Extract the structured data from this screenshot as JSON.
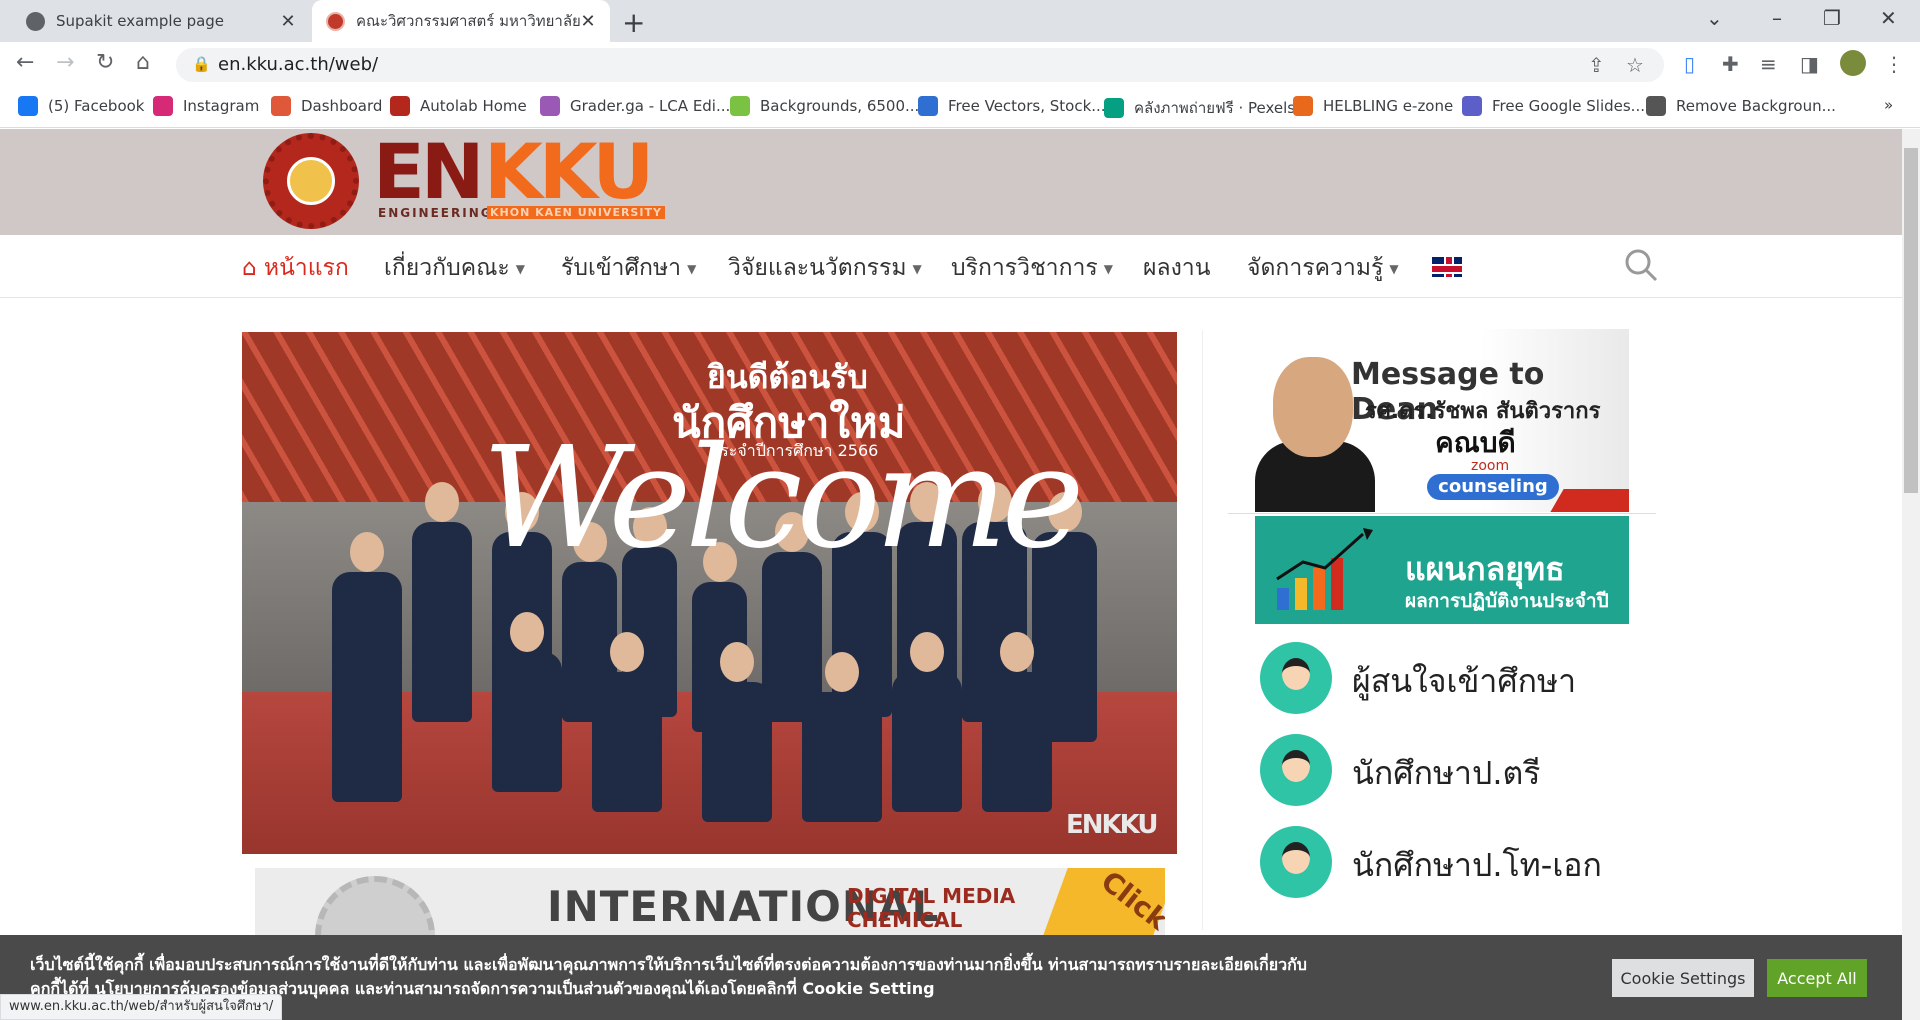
{
  "browser": {
    "tabs": [
      {
        "title": "Supakit example page",
        "active": false
      },
      {
        "title": "คณะวิศวกรรมศาสตร์ มหาวิทยาลัยขอน",
        "active": true
      }
    ],
    "new_tab_glyph": "+",
    "close_glyph": "✕",
    "address": "en.kku.ac.th/web/",
    "status_url": "www.en.kku.ac.th/web/สำหรับผู้สนใจศึกษา/",
    "bookmarks": [
      {
        "label": "(5) Facebook",
        "icon": "facebook-icon",
        "color": "#1877f2"
      },
      {
        "label": "Instagram",
        "icon": "instagram-icon",
        "color": "#d62976"
      },
      {
        "label": "Dashboard",
        "icon": "flame-icon",
        "color": "#e0583a"
      },
      {
        "label": "Autolab Home",
        "icon": "autolab-icon",
        "color": "#b3271c"
      },
      {
        "label": "Grader.ga - LCA Edi...",
        "icon": "grader-icon",
        "color": "#9b59b6"
      },
      {
        "label": "Backgrounds, 6500...",
        "icon": "backgrounds-icon",
        "color": "#7cc242"
      },
      {
        "label": "Free Vectors, Stock...",
        "icon": "vectors-icon",
        "color": "#2f6fd1"
      },
      {
        "label": "คลังภาพถ่ายฟรี · Pexels",
        "icon": "pexels-icon",
        "color": "#05a081"
      },
      {
        "label": "HELBLING e-zone",
        "icon": "helbling-icon",
        "color": "#e8681c"
      },
      {
        "label": "Free Google Slides...",
        "icon": "slides-icon",
        "color": "#5b5fc7"
      },
      {
        "label": "Remove Backgroun...",
        "icon": "removebg-icon",
        "color": "#555555"
      }
    ],
    "bookmarks_overflow": "»"
  },
  "site": {
    "logo": {
      "en": "EN",
      "kku": "KKU",
      "sub_left": "ENGINEERING",
      "sub_right": "KHON KAEN UNIVERSITY"
    },
    "nav": [
      {
        "label": "หน้าแรก",
        "dropdown": false,
        "active": true
      },
      {
        "label": "เกี่ยวกับคณะ",
        "dropdown": true
      },
      {
        "label": "รับเข้าศึกษา",
        "dropdown": true
      },
      {
        "label": "วิจัยและนวัตกรรม",
        "dropdown": true
      },
      {
        "label": "บริการวิชาการ",
        "dropdown": true
      },
      {
        "label": "ผลงาน",
        "dropdown": false
      },
      {
        "label": "จัดการความรู้",
        "dropdown": true
      }
    ],
    "caret": "▼",
    "hero": {
      "line1": "ยินดีต้อนรับ",
      "line2": "นักศึกษาใหม่",
      "line3": "ประจำปีการศึกษา 2566",
      "script": "Welcome",
      "watermark": "ENKKU"
    },
    "intl_banner": {
      "title": "INTERNATIONAL",
      "program_1": "DIGITAL MEDIA",
      "program_2": "CHEMICAL",
      "click": "Click"
    },
    "dean_card": {
      "title": "Message to Dean",
      "name": "รศ.ดร.รัชพล  สันติวรากร",
      "role": "คณบดี",
      "zoom": "zoom",
      "counseling": "counseling"
    },
    "strategy_card": {
      "title": "แผนกลยุทธ",
      "subtitle": "ผลการปฏิบัติงานประจำปี"
    },
    "quick_links": [
      {
        "label": "ผู้สนใจเข้าศึกษา",
        "icon": "prospective-student-icon"
      },
      {
        "label": "นักศึกษาป.ตรี",
        "icon": "undergraduate-icon"
      },
      {
        "label": "นักศึกษาป.โท-เอก",
        "icon": "graduate-icon"
      }
    ]
  },
  "cookie_bar": {
    "text": "เว็บไซต์นี้ใช้คุกกี้ เพื่อมอบประสบการณ์การใช้งานที่ดีให้กับท่าน และเพื่อพัฒนาคุณภาพการให้บริการเว็บไซต์ที่ตรงต่อความต้องการของท่านมากยิ่งขึ้น ท่านสามารถทราบรายละเอียดเกี่ยวกับคุกกี้ได้ที่ นโยบายการคุ้มครองข้อมูลส่วนบุคคล และท่านสามารถจัดการความเป็นส่วนตัวของคุณได้เองโดยคลิกที่ Cookie Setting",
    "settings_label": "Cookie Settings",
    "accept_label": "Accept All"
  },
  "colors": {
    "brand_red": "#d9291c",
    "brand_orange": "#f26b1d",
    "banner_bg": "#cfc8c7",
    "accept_green": "#61a229",
    "teal": "#2ec4a5"
  }
}
